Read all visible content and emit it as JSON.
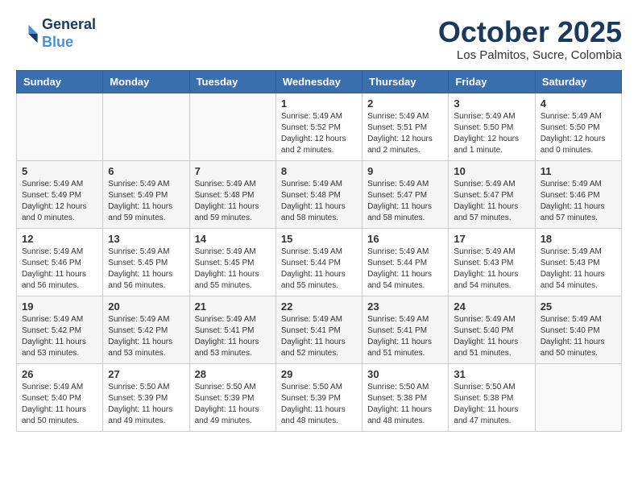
{
  "header": {
    "logo_line1": "General",
    "logo_line2": "Blue",
    "month": "October 2025",
    "location": "Los Palmitos, Sucre, Colombia"
  },
  "weekdays": [
    "Sunday",
    "Monday",
    "Tuesday",
    "Wednesday",
    "Thursday",
    "Friday",
    "Saturday"
  ],
  "weeks": [
    [
      {
        "day": "",
        "info": ""
      },
      {
        "day": "",
        "info": ""
      },
      {
        "day": "",
        "info": ""
      },
      {
        "day": "1",
        "info": "Sunrise: 5:49 AM\nSunset: 5:52 PM\nDaylight: 12 hours\nand 2 minutes."
      },
      {
        "day": "2",
        "info": "Sunrise: 5:49 AM\nSunset: 5:51 PM\nDaylight: 12 hours\nand 2 minutes."
      },
      {
        "day": "3",
        "info": "Sunrise: 5:49 AM\nSunset: 5:50 PM\nDaylight: 12 hours\nand 1 minute."
      },
      {
        "day": "4",
        "info": "Sunrise: 5:49 AM\nSunset: 5:50 PM\nDaylight: 12 hours\nand 0 minutes."
      }
    ],
    [
      {
        "day": "5",
        "info": "Sunrise: 5:49 AM\nSunset: 5:49 PM\nDaylight: 12 hours\nand 0 minutes."
      },
      {
        "day": "6",
        "info": "Sunrise: 5:49 AM\nSunset: 5:49 PM\nDaylight: 11 hours\nand 59 minutes."
      },
      {
        "day": "7",
        "info": "Sunrise: 5:49 AM\nSunset: 5:48 PM\nDaylight: 11 hours\nand 59 minutes."
      },
      {
        "day": "8",
        "info": "Sunrise: 5:49 AM\nSunset: 5:48 PM\nDaylight: 11 hours\nand 58 minutes."
      },
      {
        "day": "9",
        "info": "Sunrise: 5:49 AM\nSunset: 5:47 PM\nDaylight: 11 hours\nand 58 minutes."
      },
      {
        "day": "10",
        "info": "Sunrise: 5:49 AM\nSunset: 5:47 PM\nDaylight: 11 hours\nand 57 minutes."
      },
      {
        "day": "11",
        "info": "Sunrise: 5:49 AM\nSunset: 5:46 PM\nDaylight: 11 hours\nand 57 minutes."
      }
    ],
    [
      {
        "day": "12",
        "info": "Sunrise: 5:49 AM\nSunset: 5:46 PM\nDaylight: 11 hours\nand 56 minutes."
      },
      {
        "day": "13",
        "info": "Sunrise: 5:49 AM\nSunset: 5:45 PM\nDaylight: 11 hours\nand 56 minutes."
      },
      {
        "day": "14",
        "info": "Sunrise: 5:49 AM\nSunset: 5:45 PM\nDaylight: 11 hours\nand 55 minutes."
      },
      {
        "day": "15",
        "info": "Sunrise: 5:49 AM\nSunset: 5:44 PM\nDaylight: 11 hours\nand 55 minutes."
      },
      {
        "day": "16",
        "info": "Sunrise: 5:49 AM\nSunset: 5:44 PM\nDaylight: 11 hours\nand 54 minutes."
      },
      {
        "day": "17",
        "info": "Sunrise: 5:49 AM\nSunset: 5:43 PM\nDaylight: 11 hours\nand 54 minutes."
      },
      {
        "day": "18",
        "info": "Sunrise: 5:49 AM\nSunset: 5:43 PM\nDaylight: 11 hours\nand 54 minutes."
      }
    ],
    [
      {
        "day": "19",
        "info": "Sunrise: 5:49 AM\nSunset: 5:42 PM\nDaylight: 11 hours\nand 53 minutes."
      },
      {
        "day": "20",
        "info": "Sunrise: 5:49 AM\nSunset: 5:42 PM\nDaylight: 11 hours\nand 53 minutes."
      },
      {
        "day": "21",
        "info": "Sunrise: 5:49 AM\nSunset: 5:41 PM\nDaylight: 11 hours\nand 53 minutes."
      },
      {
        "day": "22",
        "info": "Sunrise: 5:49 AM\nSunset: 5:41 PM\nDaylight: 11 hours\nand 52 minutes."
      },
      {
        "day": "23",
        "info": "Sunrise: 5:49 AM\nSunset: 5:41 PM\nDaylight: 11 hours\nand 51 minutes."
      },
      {
        "day": "24",
        "info": "Sunrise: 5:49 AM\nSunset: 5:40 PM\nDaylight: 11 hours\nand 51 minutes."
      },
      {
        "day": "25",
        "info": "Sunrise: 5:49 AM\nSunset: 5:40 PM\nDaylight: 11 hours\nand 50 minutes."
      }
    ],
    [
      {
        "day": "26",
        "info": "Sunrise: 5:49 AM\nSunset: 5:40 PM\nDaylight: 11 hours\nand 50 minutes."
      },
      {
        "day": "27",
        "info": "Sunrise: 5:50 AM\nSunset: 5:39 PM\nDaylight: 11 hours\nand 49 minutes."
      },
      {
        "day": "28",
        "info": "Sunrise: 5:50 AM\nSunset: 5:39 PM\nDaylight: 11 hours\nand 49 minutes."
      },
      {
        "day": "29",
        "info": "Sunrise: 5:50 AM\nSunset: 5:39 PM\nDaylight: 11 hours\nand 48 minutes."
      },
      {
        "day": "30",
        "info": "Sunrise: 5:50 AM\nSunset: 5:38 PM\nDaylight: 11 hours\nand 48 minutes."
      },
      {
        "day": "31",
        "info": "Sunrise: 5:50 AM\nSunset: 5:38 PM\nDaylight: 11 hours\nand 47 minutes."
      },
      {
        "day": "",
        "info": ""
      }
    ]
  ]
}
